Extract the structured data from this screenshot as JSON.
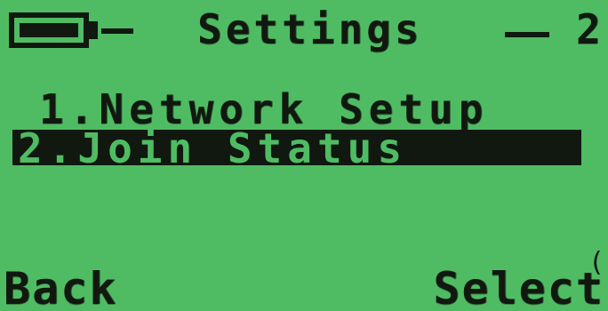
{
  "header": {
    "title": "Settings",
    "page_number": "2",
    "battery_icon": "battery-icon"
  },
  "menu": {
    "items": [
      {
        "label": "1.Network Setup",
        "selected": false
      },
      {
        "label": "2.Join Status",
        "selected": true
      }
    ]
  },
  "scroll_indicator": "(",
  "softkeys": {
    "left_label": "Back",
    "right_label": "Select"
  },
  "colors": {
    "lcd_background": "#4fbc63",
    "lcd_foreground": "#101810"
  }
}
